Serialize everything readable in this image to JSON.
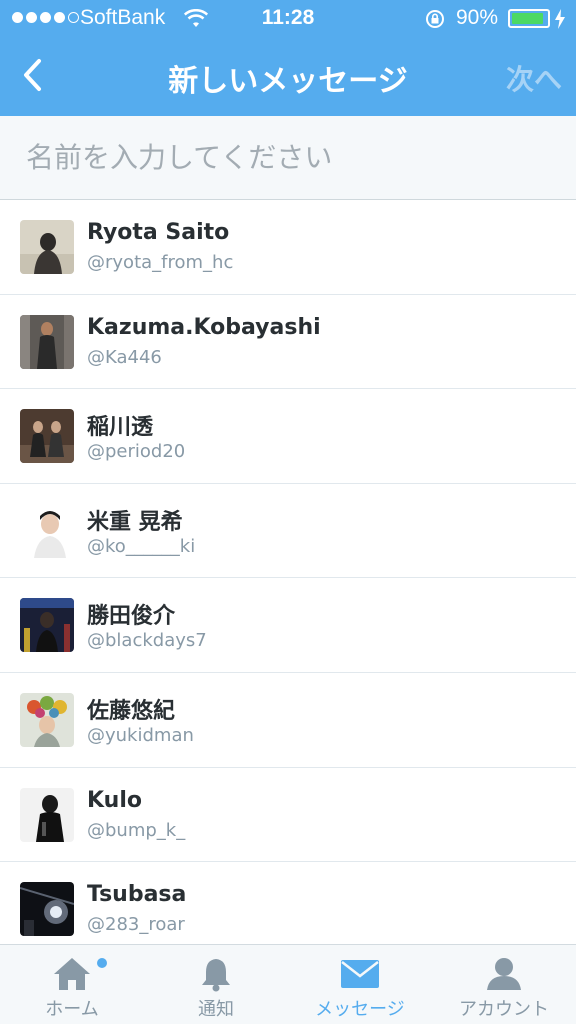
{
  "status_bar": {
    "carrier": "SoftBank",
    "time": "11:28",
    "battery_percent_text": "90%",
    "battery_level": 0.9
  },
  "nav": {
    "title": "新しいメッセージ",
    "next_label": "次へ"
  },
  "search": {
    "placeholder": "名前を入力してください"
  },
  "contacts": [
    {
      "name": "Ryota Saito",
      "handle": "@ryota_from_hc"
    },
    {
      "name": "Kazuma.Kobayashi",
      "handle": "@Ka446"
    },
    {
      "name": "稲川透",
      "handle": "@period20"
    },
    {
      "name": "米重 晃希",
      "handle": "@ko______ki"
    },
    {
      "name": "勝田俊介",
      "handle": "@blackdays7"
    },
    {
      "name": "佐藤悠紀",
      "handle": "@yukidman"
    },
    {
      "name": "Kulo",
      "handle": "@bump_k_"
    },
    {
      "name": "Tsubasa",
      "handle": "@283_roar"
    }
  ],
  "tabs": [
    {
      "label": "ホーム",
      "icon": "home-icon"
    },
    {
      "label": "通知",
      "icon": "bell-icon"
    },
    {
      "label": "メッセージ",
      "icon": "envelope-icon"
    },
    {
      "label": "アカウント",
      "icon": "person-icon"
    }
  ],
  "colors": {
    "accent": "#55acee",
    "battery_fill": "#4cd964",
    "inactive_tab": "#8899a6"
  }
}
